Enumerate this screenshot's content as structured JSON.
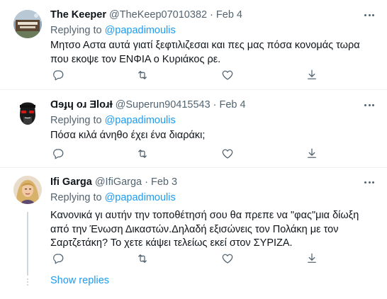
{
  "tweets": [
    {
      "name": "The Keeper",
      "handle": "@TheKeep07010382",
      "dot": "·",
      "date": "Feb 4",
      "replying_prefix": "Replying to",
      "replying_to": "@papadimoulis",
      "text": "Μητσο Αστα αυτά γιατί ξεφτιλιζεσαι και πες μας πόσα κονομάς τωρα που εκοψε τον ΕΝΦΙΑ ο Κυριάκος ρε."
    },
    {
      "name": "Ɑɘɟɥ oɹ ƎloɹƗ",
      "handle": "@Superun90415543",
      "dot": "·",
      "date": "Feb 4",
      "replying_prefix": "Replying to",
      "replying_to": "@papadimoulis",
      "text": "Πόσα κιλά άνηθο έχει ένα διαράκι;"
    },
    {
      "name": "Ifi Garga",
      "handle": "@IfiGarga",
      "dot": "·",
      "date": "Feb 3",
      "replying_prefix": "Replying to",
      "replying_to": "@papadimoulis",
      "text": "Κανονικά γι αυτήν την τοποθέτησή σου θα πρεπε να \"φας\"μια δίωξη από την Ένωση Δικαστών.Δηλαδή εξισώνεις τον Πολάκη με τον Σαρτζετάκη? Το χετε κάψει τελείως εκεί στον ΣΥΡΙΖΑ."
    }
  ],
  "icons": {
    "more": "more-horizontal-icon",
    "reply": "reply-bubble-icon",
    "retweet": "retweet-icon",
    "like": "heart-icon",
    "share": "share-icon"
  },
  "show_replies": "Show replies",
  "colors": {
    "accent": "#1d9bf0",
    "text": "#0f1419",
    "secondary": "#536471",
    "separator": "#eff3f4",
    "thread_line": "#cfd9de"
  }
}
